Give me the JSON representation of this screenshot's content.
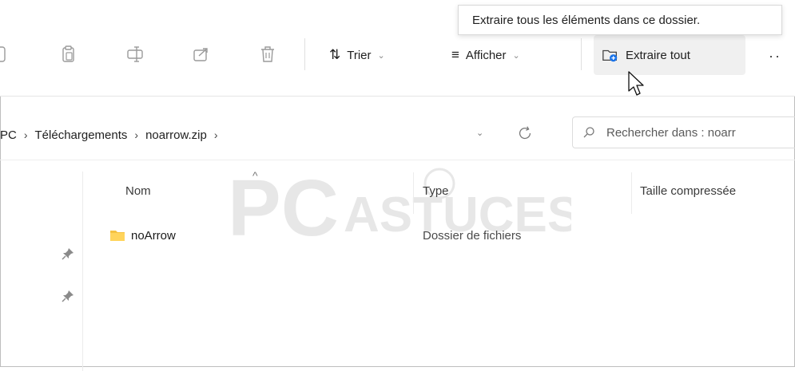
{
  "tooltip": "Extraire tous les éléments dans ce dossier.",
  "toolbar": {
    "sort_label": "Trier",
    "view_label": "Afficher",
    "extract_all_label": "Extraire tout",
    "more_label": "··",
    "icons": [
      "cut-icon",
      "copy-icon",
      "rename-icon",
      "share-icon",
      "delete-icon"
    ]
  },
  "address": {
    "crumbs": [
      "PC",
      "Téléchargements",
      "noarrow.zip"
    ],
    "separator": "›"
  },
  "search": {
    "placeholder": "Rechercher dans : noarr"
  },
  "columns": {
    "name": "Nom",
    "type": "Type",
    "compressed_size": "Taille compressée"
  },
  "rows": [
    {
      "name": "noArrow",
      "type": "Dossier de fichiers"
    }
  ],
  "colors": {
    "accent": "#1a73e8",
    "folder": "#f5c242",
    "active_bg": "#f0f0f0"
  }
}
